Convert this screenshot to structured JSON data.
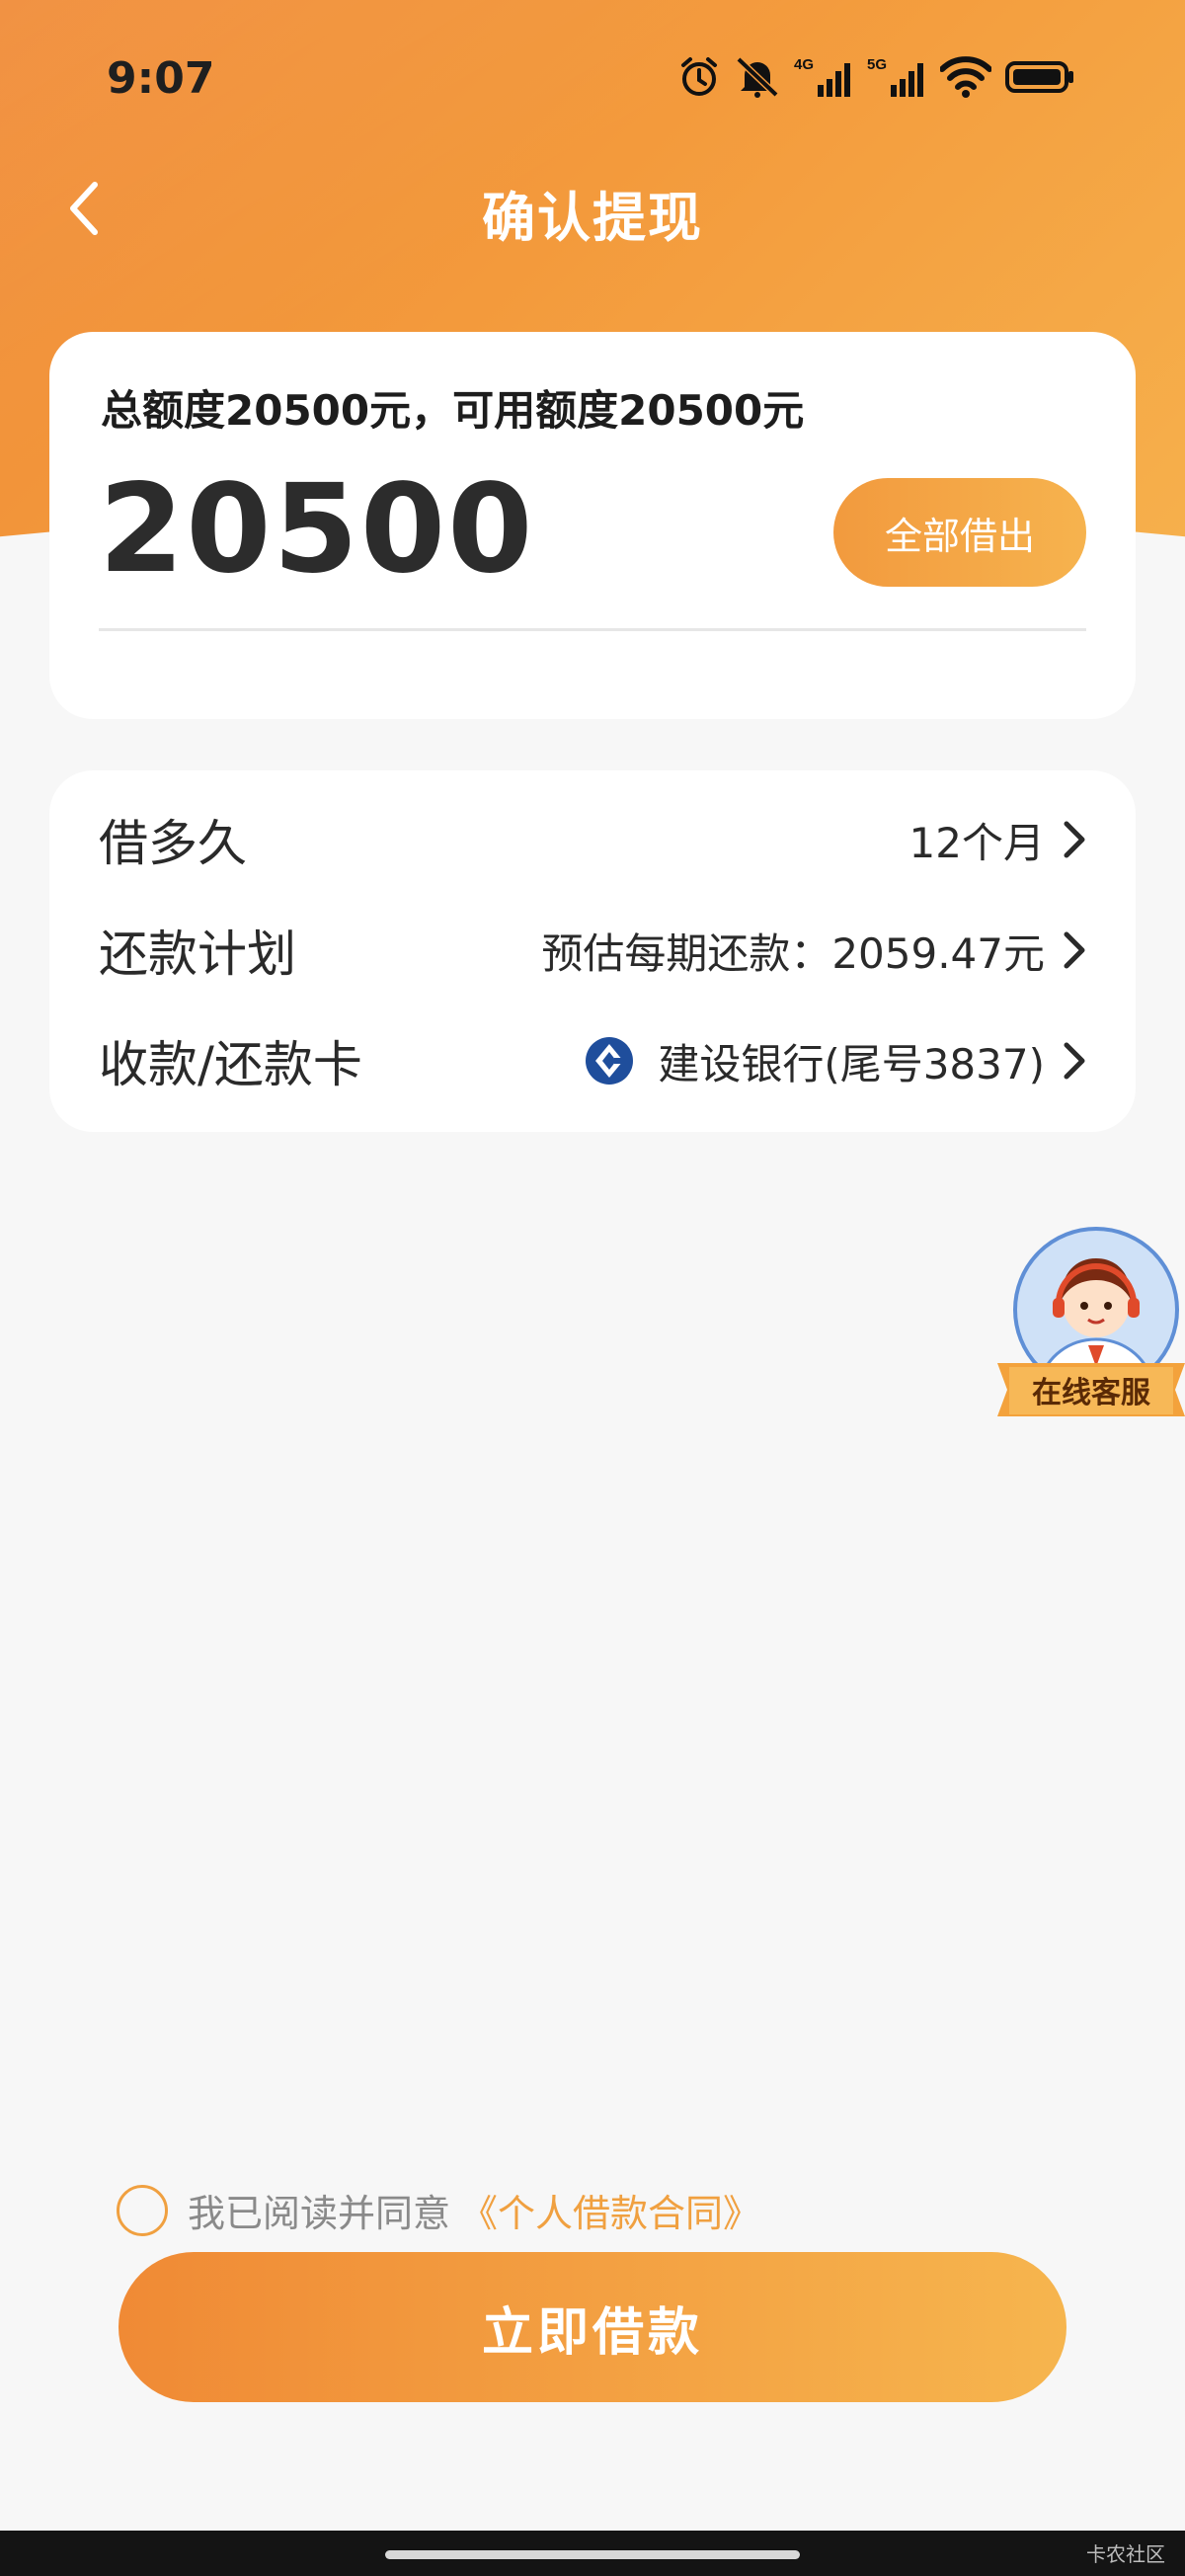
{
  "status_bar": {
    "time": "9:07",
    "icons": [
      "alarm-icon",
      "mute-icon",
      "signal-4g-icon",
      "signal-5g-icon",
      "wifi-icon",
      "battery-icon"
    ],
    "net1": "4G",
    "net2": "5G"
  },
  "nav": {
    "title": "确认提现",
    "back_icon": "chevron-left-icon"
  },
  "amount_card": {
    "credit_text": "总额度20500元，可用额度20500元",
    "amount": "20500",
    "borrow_all_label": "全部借出"
  },
  "details": {
    "term": {
      "label": "借多久",
      "value": "12个月"
    },
    "plan": {
      "label": "还款计划",
      "value": "预估每期还款：2059.47元"
    },
    "card": {
      "label": "收款/还款卡",
      "value": "建设银行(尾号3837)",
      "icon": "ccb-bank-logo-icon"
    }
  },
  "customer_service": {
    "label": "在线客服"
  },
  "agreement": {
    "text": "我已阅读并同意",
    "link": "《个人借款合同》"
  },
  "submit": {
    "label": "立即借款"
  },
  "watermark": "卡农社区",
  "colors": {
    "primary_orange": "#f08a35",
    "light_orange": "#f6b34e",
    "link_orange": "#f0a040",
    "bank_blue": "#1f4e9c"
  }
}
